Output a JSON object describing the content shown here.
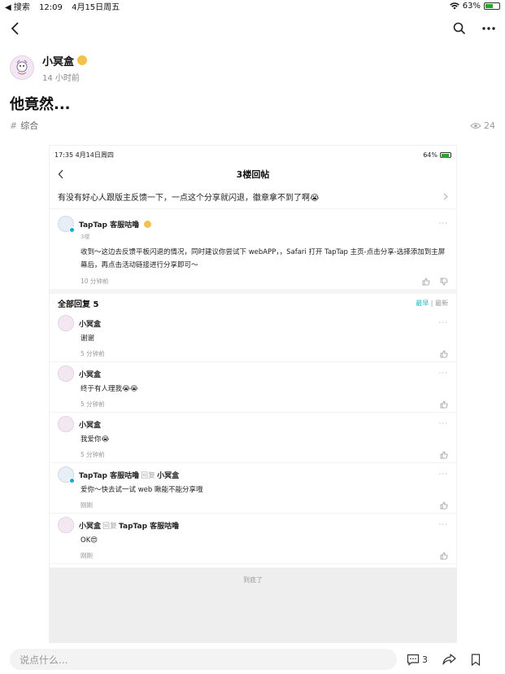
{
  "status_bar": {
    "back_app": "◀ 搜索",
    "time": "12:09",
    "date": "4月15日周五",
    "battery": "63%"
  },
  "author": {
    "name": "小冥盒",
    "time": "14 小时前"
  },
  "post": {
    "title": "他竟然...",
    "tag": "综合",
    "views": "24"
  },
  "screenshot": {
    "status_time": "17:35  4月14日周四",
    "status_battery": "64%",
    "nav_title": "3楼回帖",
    "question": "有没有好心人跟版主反馈一下，一点这个分享就闪退，徽章拿不到了啊😭",
    "main_reply": {
      "name": "TapTap 客服咕噜",
      "floor": "3楼",
      "text": "收到～这边去反馈平板闪退的情况，同时建议你尝试下 webAPP，，Safari 打开 TapTap 主页-点击分享-选择添加到主屏幕后，再点击活动链接进行分享即可～",
      "time": "10 分钟前"
    },
    "all_replies_label": "全部回复 5",
    "sort_newest_first": "最早",
    "sort_separator": "|",
    "sort_latest": "最新",
    "comments": [
      {
        "name": "小冥盒",
        "reply_word": "",
        "reply_to": "",
        "text": "谢谢",
        "time": "5 分钟前"
      },
      {
        "name": "小冥盒",
        "reply_word": "",
        "reply_to": "",
        "text": "终于有人理我😭😭",
        "time": "5 分钟前"
      },
      {
        "name": "小冥盒",
        "reply_word": "",
        "reply_to": "",
        "text": "我爱你😭",
        "time": "5 分钟前"
      },
      {
        "name": "TapTap 客服咕噜",
        "reply_word": "回复",
        "reply_to": "小冥盒",
        "text": "爱你～快去试一试 web 瞅能不能分享哦",
        "time": "刚刚"
      },
      {
        "name": "小冥盒",
        "reply_word": "回复",
        "reply_to": "TapTap 客服咕噜",
        "text": "OK😍",
        "time": "刚刚"
      }
    ],
    "end_text": "到底了"
  },
  "bottom_bar": {
    "input_placeholder": "说点什么...",
    "comment_count": "3"
  }
}
